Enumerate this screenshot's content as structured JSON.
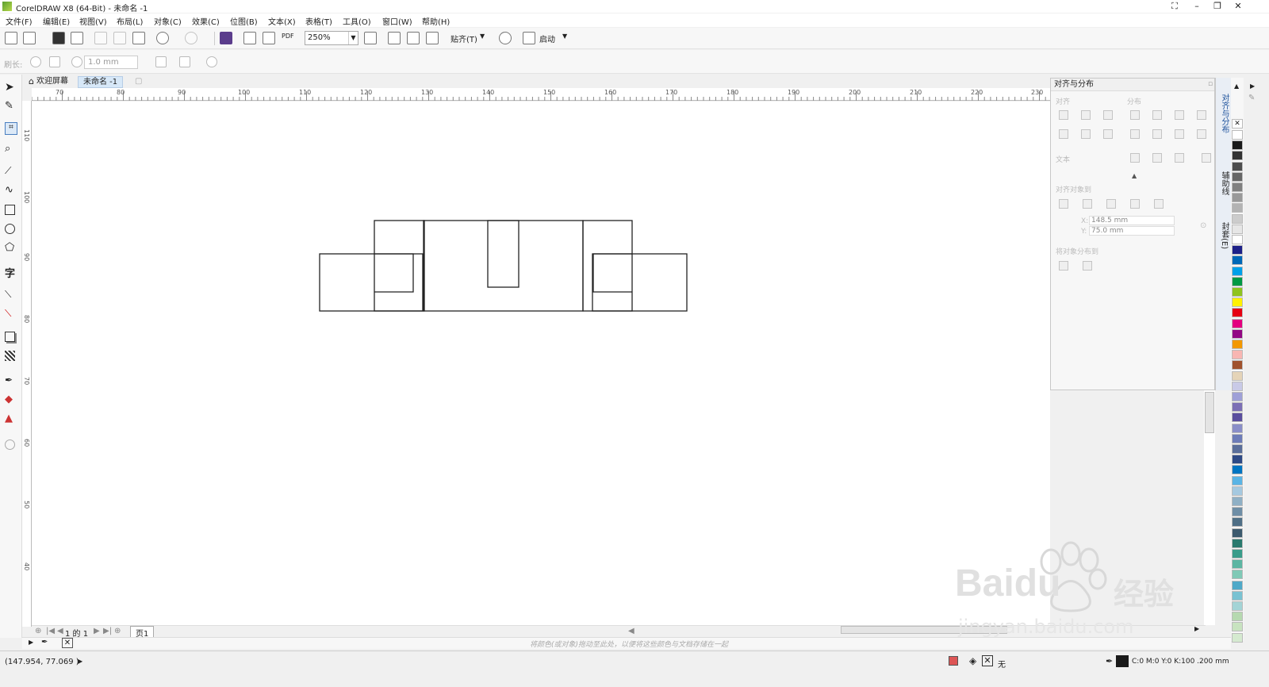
{
  "window": {
    "title": "CorelDRAW X8 (64-Bit) - 未命名 -1"
  },
  "menubar": [
    "文件(F)",
    "编辑(E)",
    "视图(V)",
    "布局(L)",
    "对象(C)",
    "效果(C)",
    "位图(B)",
    "文本(X)",
    "表格(T)",
    "工具(O)",
    "窗口(W)",
    "帮助(H)"
  ],
  "toolbar": {
    "zoom": "250%",
    "snap_label": "贴齐(T)",
    "launch_label": "启动",
    "pdf_label": "PDF"
  },
  "property_bar": {
    "corner_label": "刷长:",
    "outline_width": "1.0 mm"
  },
  "doc_tabs": [
    "欢迎屏幕",
    "未命名 -1"
  ],
  "rulers": {
    "h_ticks": [
      "70",
      "80",
      "90",
      "100",
      "110",
      "120",
      "130",
      "140",
      "150",
      "160",
      "170",
      "180",
      "190",
      "200",
      "210",
      "220",
      "230"
    ],
    "v_ticks": [
      "110",
      "100",
      "90",
      "80",
      "70",
      "60",
      "50",
      "40"
    ]
  },
  "docker": {
    "title": "对齐与分布",
    "align_label": "对齐",
    "distribute_label": "分布",
    "text_label": "文本",
    "align_objects_to": "对齐对象到",
    "x_label": "X:",
    "x_value": "148.5 mm",
    "y_label": "Y:",
    "y_value": "75.0 mm",
    "distribute_to": "将对象分布到",
    "side_tabs": [
      "对齐与分布",
      "辅助线",
      "封套(E)"
    ]
  },
  "pagebar": {
    "page_info": "1 的 1",
    "page_tab": "页1"
  },
  "colorbar": {
    "hint": "将颜色(或对象)拖动至此处，以便将这些颜色与文档存储在一起"
  },
  "status": {
    "coords": "(147.954, 77.069 )",
    "fill_label": "无",
    "outline_info": "C:0 M:0 Y:0 K:100 .200 mm"
  },
  "watermark": {
    "brand": "Baidu",
    "brand_cn": "经验",
    "url": "jingyan.baidu.com"
  },
  "palette_colors": [
    "#ffffff",
    "#1a1a1a",
    "#333333",
    "#4d4d4d",
    "#666666",
    "#808080",
    "#999999",
    "#b3b3b3",
    "#cccccc",
    "#e6e6e6",
    "#ffffff",
    "#1d2088",
    "#0068b7",
    "#00a0e9",
    "#009944",
    "#8fc31f",
    "#fff100",
    "#e60012",
    "#e4007f",
    "#920783",
    "#f39800",
    "#f8b6b2",
    "#a0522d",
    "#e5d4b8",
    "#c9cae7",
    "#9fa0d7",
    "#7c6fb5",
    "#5a4e9e",
    "#8a8ec8",
    "#6d7cb8",
    "#5a6e9a",
    "#2e4a86",
    "#0075c2",
    "#5ab4e5",
    "#a5c9e0",
    "#8fb0c5",
    "#6e8ea6",
    "#4f6f86",
    "#3c5a6e",
    "#2a7a6e",
    "#3a9c8a",
    "#5cb5a2",
    "#7fc9b6",
    "#4fa9c8",
    "#79c2d2",
    "#a3d4d6",
    "#b6d9b0",
    "#c8e3c0",
    "#d5ead0"
  ]
}
